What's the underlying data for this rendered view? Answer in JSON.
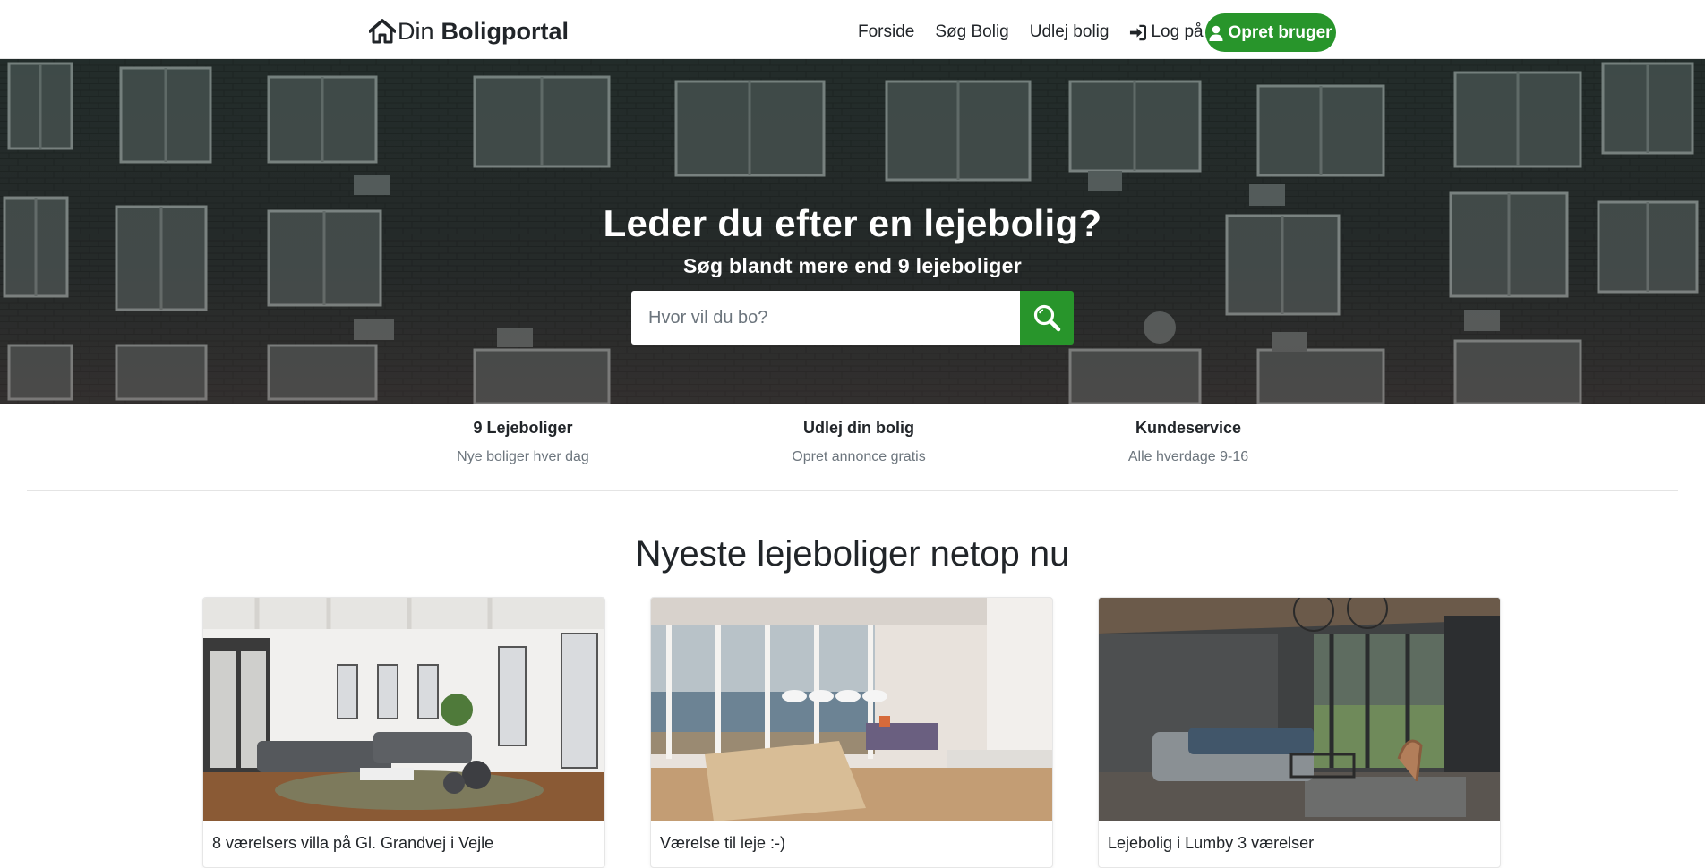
{
  "brand": {
    "prefix": "Din",
    "name": "Boligportal"
  },
  "nav": {
    "items": [
      "Forside",
      "Søg Bolig",
      "Udlej bolig"
    ],
    "login_label": "Log på",
    "signup_label": "Opret bruger"
  },
  "hero": {
    "title": "Leder du efter en lejebolig?",
    "subtitle": "Søg blandt mere end 9 lejeboliger",
    "search_placeholder": "Hvor vil du bo?"
  },
  "features": [
    {
      "title": "9 Lejeboliger",
      "subtitle": "Nye boliger hver dag"
    },
    {
      "title": "Udlej din bolig",
      "subtitle": "Opret annonce gratis"
    },
    {
      "title": "Kundeservice",
      "subtitle": "Alle hverdage 9-16"
    }
  ],
  "listings": {
    "heading": "Nyeste lejeboliger netop nu",
    "items": [
      {
        "title": "8 værelsers villa på Gl. Grandvej i Vejle"
      },
      {
        "title": "Værelse til leje :-)"
      },
      {
        "title": "Lejebolig i Lumby 3 værelser"
      }
    ]
  },
  "colors": {
    "accent": "#28952b",
    "text": "#212529",
    "muted": "#6c757d"
  },
  "icons": {
    "brand": "home-icon",
    "login": "sign-in-icon",
    "signup": "user-icon",
    "search": "search-icon"
  }
}
